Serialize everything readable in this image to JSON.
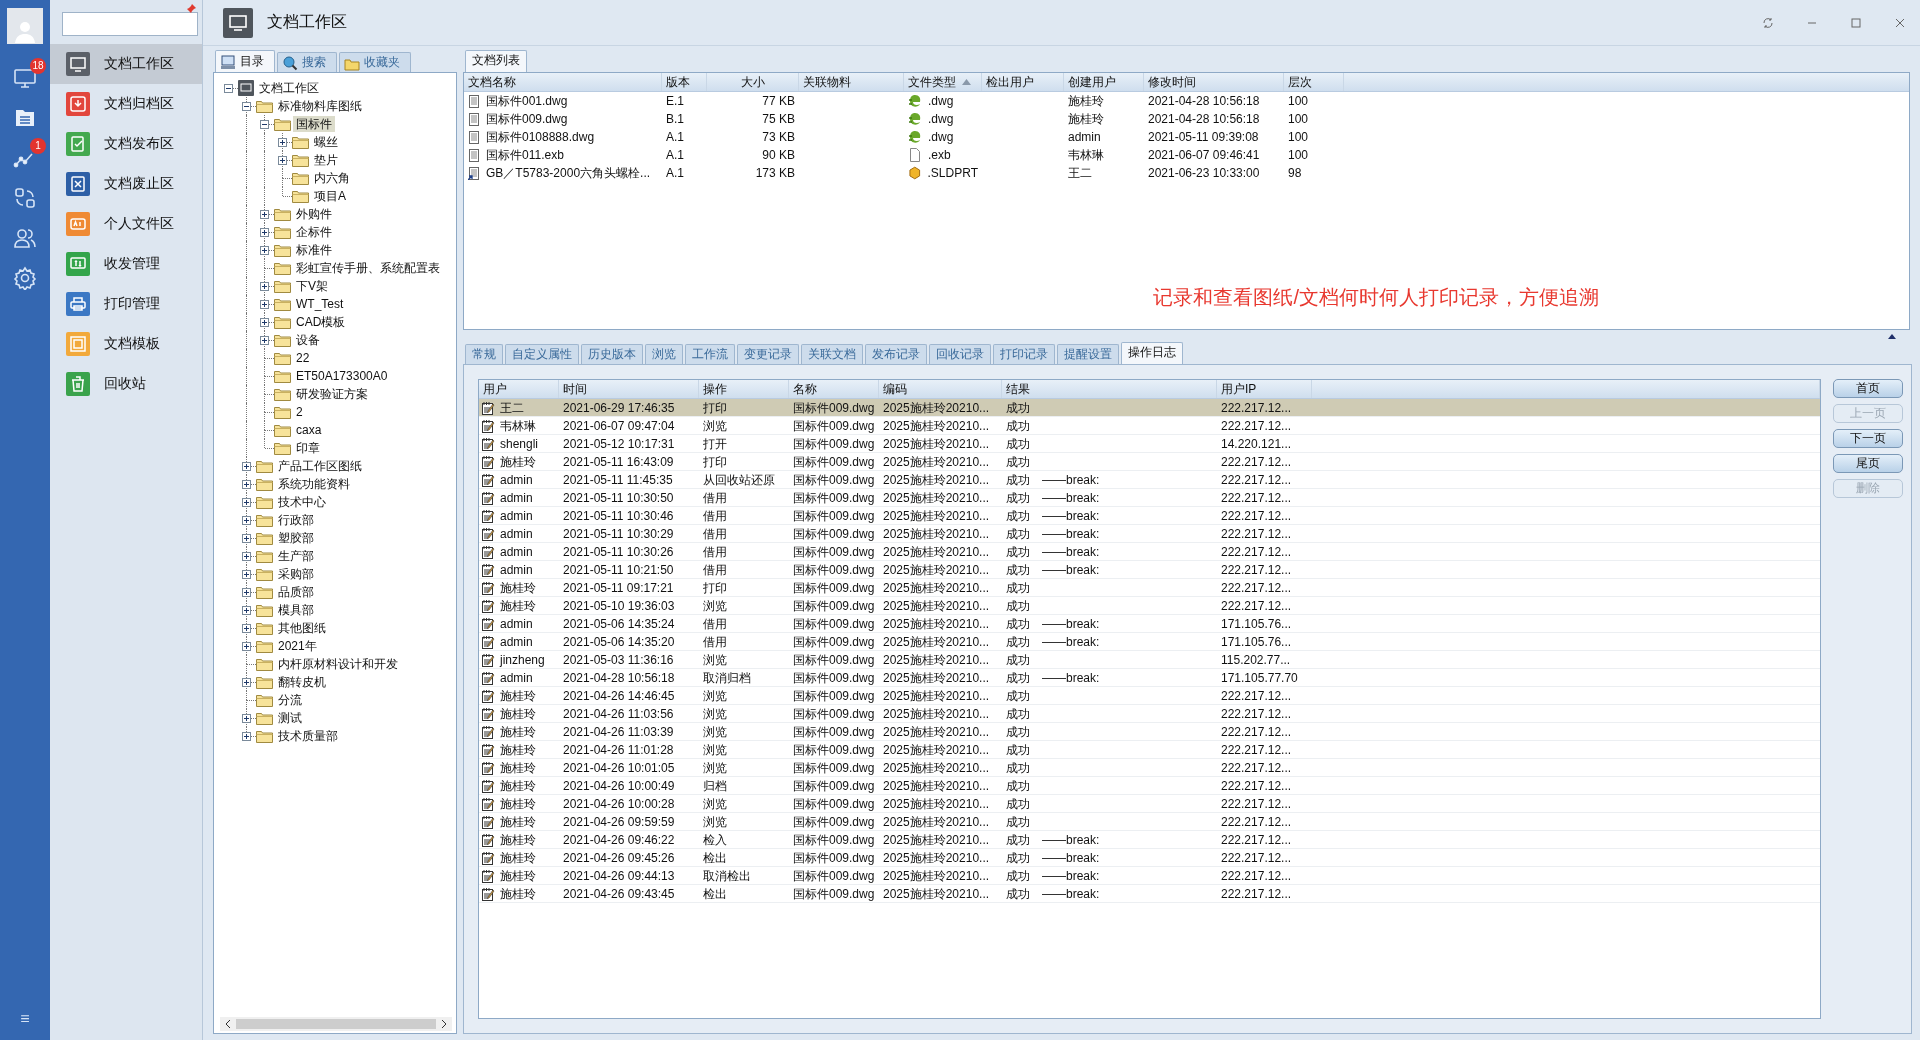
{
  "rail": {
    "items": [
      {
        "kind": "monitor",
        "badge": "18"
      },
      {
        "kind": "list"
      },
      {
        "kind": "chart",
        "badge": "1"
      },
      {
        "kind": "sync"
      },
      {
        "kind": "users"
      },
      {
        "kind": "gear"
      }
    ],
    "menu": "≡"
  },
  "nav": [
    {
      "label": "文档工作区",
      "kind": "monitor",
      "selected": true
    },
    {
      "label": "文档归档区",
      "kind": "archive",
      "selected": false
    },
    {
      "label": "文档发布区",
      "kind": "publish",
      "selected": false
    },
    {
      "label": "文档废止区",
      "kind": "void",
      "selected": false
    },
    {
      "label": "个人文件区",
      "kind": "personal",
      "selected": false
    },
    {
      "label": "收发管理",
      "kind": "transfer",
      "selected": false
    },
    {
      "label": "打印管理",
      "kind": "printer",
      "selected": false
    },
    {
      "label": "文档模板",
      "kind": "template",
      "selected": false
    },
    {
      "label": "回收站",
      "kind": "trash",
      "selected": false
    }
  ],
  "title": "文档工作区",
  "tree_tabs": [
    {
      "label": "目录",
      "kind": "catalog",
      "selected": true
    },
    {
      "label": "搜索",
      "kind": "search",
      "selected": false
    },
    {
      "label": "收藏夹",
      "kind": "favorites",
      "selected": false
    }
  ],
  "tree": {
    "label": "文档工作区",
    "expanded": true,
    "selected": false,
    "children": [
      {
        "label": "标准物料库图纸",
        "expanded": true,
        "selected": false,
        "children": [
          {
            "label": "国标件",
            "expanded": true,
            "selected": true,
            "children": [
              {
                "label": "螺丝",
                "expanded": false,
                "selected": false
              },
              {
                "label": "垫片",
                "expanded": false,
                "selected": false
              },
              {
                "label": "内六角",
                "selected": false
              },
              {
                "label": "项目A",
                "selected": false
              }
            ]
          },
          {
            "label": "外购件",
            "expanded": false,
            "selected": false
          },
          {
            "label": "企标件",
            "expanded": false,
            "selected": false
          },
          {
            "label": "标准件",
            "expanded": false,
            "selected": false
          },
          {
            "label": "彩虹宣传手册、系统配置表",
            "selected": false
          },
          {
            "label": "下V架",
            "expanded": false,
            "selected": false
          },
          {
            "label": "WT_Test",
            "expanded": false,
            "selected": false
          },
          {
            "label": "CAD模板",
            "expanded": false,
            "selected": false
          },
          {
            "label": "设备",
            "expanded": false,
            "selected": false
          },
          {
            "label": "22",
            "selected": false
          },
          {
            "label": "ET50A173300A0",
            "selected": false
          },
          {
            "label": "研发验证方案",
            "selected": false
          },
          {
            "label": "2",
            "selected": false
          },
          {
            "label": "caxa",
            "selected": false
          },
          {
            "label": "印章",
            "selected": false
          }
        ]
      },
      {
        "label": "产品工作区图纸",
        "expanded": false,
        "selected": false
      },
      {
        "label": "系统功能资料",
        "expanded": false,
        "selected": false
      },
      {
        "label": "技术中心",
        "expanded": false,
        "selected": false
      },
      {
        "label": "行政部",
        "expanded": false,
        "selected": false
      },
      {
        "label": "塑胶部",
        "expanded": false,
        "selected": false
      },
      {
        "label": "生产部",
        "expanded": false,
        "selected": false
      },
      {
        "label": "采购部",
        "expanded": false,
        "selected": false
      },
      {
        "label": "品质部",
        "expanded": false,
        "selected": false
      },
      {
        "label": "模具部",
        "expanded": false,
        "selected": false
      },
      {
        "label": "其他图纸",
        "expanded": false,
        "selected": false
      },
      {
        "label": "2021年",
        "expanded": false,
        "selected": false
      },
      {
        "label": "内杆原材料设计和开发",
        "selected": false
      },
      {
        "label": "翻转皮机",
        "expanded": false,
        "selected": false
      },
      {
        "label": "分流",
        "selected": false
      },
      {
        "label": "测试",
        "expanded": false,
        "selected": false
      },
      {
        "label": "技术质量部",
        "expanded": false,
        "selected": false
      }
    ]
  },
  "doc_list": {
    "tab": "文档列表",
    "columns": [
      {
        "label": "文档名称"
      },
      {
        "label": "版本"
      },
      {
        "label": "大小"
      },
      {
        "label": "关联物料"
      },
      {
        "label": "文件类型",
        "sorted": true
      },
      {
        "label": "检出用户"
      },
      {
        "label": "创建用户"
      },
      {
        "label": "修改时间"
      },
      {
        "label": "层次"
      }
    ],
    "rows": [
      {
        "kind": "document",
        "name": "国标件001.dwg",
        "version": "E.1",
        "size": "77 KB",
        "file_type": {
          "kind": "dwg",
          "text": ".dwg"
        },
        "creator": "施桂玲",
        "modified": "2021-04-28 10:56:18",
        "layer": "100"
      },
      {
        "kind": "document",
        "name": "国标件009.dwg",
        "version": "B.1",
        "size": "75 KB",
        "file_type": {
          "kind": "dwg",
          "text": ".dwg"
        },
        "creator": "施桂玲",
        "modified": "2021-04-28 10:56:18",
        "layer": "100"
      },
      {
        "kind": "document",
        "name": "国标件0108888.dwg",
        "version": "A.1",
        "size": "73 KB",
        "file_type": {
          "kind": "dwg",
          "text": ".dwg"
        },
        "creator": "admin",
        "modified": "2021-05-11 09:39:08",
        "layer": "100"
      },
      {
        "kind": "document",
        "name": "国标件011.exb",
        "version": "A.1",
        "size": "90 KB",
        "file_type": {
          "kind": "exb",
          "text": ".exb"
        },
        "creator": "韦林琳",
        "modified": "2021-06-07 09:46:41",
        "layer": "100"
      },
      {
        "kind": "shortcut",
        "name": "GB／T5783-2000六角头螺栓...",
        "version": "A.1",
        "size": "173 KB",
        "file_type": {
          "kind": "sldprt",
          "text": ".SLDPRT"
        },
        "creator": "王二",
        "modified": "2021-06-23 10:33:00",
        "layer": "98"
      }
    ]
  },
  "annotation": "记录和查看图纸/文档何时何人打印记录，方便追溯",
  "detail_tabs": [
    {
      "label": "常规",
      "selected": false
    },
    {
      "label": "自定义属性",
      "selected": false
    },
    {
      "label": "历史版本",
      "selected": false
    },
    {
      "label": "浏览",
      "selected": false
    },
    {
      "label": "工作流",
      "selected": false
    },
    {
      "label": "变更记录",
      "selected": false
    },
    {
      "label": "关联文档",
      "selected": false
    },
    {
      "label": "发布记录",
      "selected": false
    },
    {
      "label": "回收记录",
      "selected": false
    },
    {
      "label": "打印记录",
      "selected": false
    },
    {
      "label": "提醒设置",
      "selected": false
    },
    {
      "label": "操作日志",
      "selected": true
    }
  ],
  "log": {
    "columns": [
      "用户",
      "时间",
      "操作",
      "名称",
      "编码",
      "结果",
      "用户IP"
    ],
    "rows": [
      {
        "user": "王二",
        "time": "2021-06-29 17:46:35",
        "action": "打印",
        "name": "国标件009.dwg",
        "code": "2025施桂玲20210...",
        "result": "成功",
        "ip": "222.217.12...",
        "selected": true
      },
      {
        "user": "韦林琳",
        "time": "2021-06-07 09:47:04",
        "action": "浏览",
        "name": "国标件009.dwg",
        "code": "2025施桂玲20210...",
        "result": "成功",
        "ip": "222.217.12...",
        "selected": false
      },
      {
        "user": "shengli",
        "time": "2021-05-12 10:17:31",
        "action": "打开",
        "name": "国标件009.dwg",
        "code": "2025施桂玲20210...",
        "result": "成功",
        "ip": "14.220.121...",
        "selected": false
      },
      {
        "user": "施桂玲",
        "time": "2021-05-11 16:43:09",
        "action": "打印",
        "name": "国标件009.dwg",
        "code": "2025施桂玲20210...",
        "result": "成功",
        "ip": "222.217.12...",
        "selected": false
      },
      {
        "user": "admin",
        "time": "2021-05-11 11:45:35",
        "action": "从回收站还原",
        "name": "国标件009.dwg",
        "code": "2025施桂玲20210...",
        "result": "成功",
        "note": "——break:",
        "ip": "222.217.12...",
        "selected": false
      },
      {
        "user": "admin",
        "time": "2021-05-11 10:30:50",
        "action": "借用",
        "name": "国标件009.dwg",
        "code": "2025施桂玲20210...",
        "result": "成功",
        "note": "——break:",
        "ip": "222.217.12...",
        "selected": false
      },
      {
        "user": "admin",
        "time": "2021-05-11 10:30:46",
        "action": "借用",
        "name": "国标件009.dwg",
        "code": "2025施桂玲20210...",
        "result": "成功",
        "note": "——break:",
        "ip": "222.217.12...",
        "selected": false
      },
      {
        "user": "admin",
        "time": "2021-05-11 10:30:29",
        "action": "借用",
        "name": "国标件009.dwg",
        "code": "2025施桂玲20210...",
        "result": "成功",
        "note": "——break:",
        "ip": "222.217.12...",
        "selected": false
      },
      {
        "user": "admin",
        "time": "2021-05-11 10:30:26",
        "action": "借用",
        "name": "国标件009.dwg",
        "code": "2025施桂玲20210...",
        "result": "成功",
        "note": "——break:",
        "ip": "222.217.12...",
        "selected": false
      },
      {
        "user": "admin",
        "time": "2021-05-11 10:21:50",
        "action": "借用",
        "name": "国标件009.dwg",
        "code": "2025施桂玲20210...",
        "result": "成功",
        "note": "——break:",
        "ip": "222.217.12...",
        "selected": false
      },
      {
        "user": "施桂玲",
        "time": "2021-05-11 09:17:21",
        "action": "打印",
        "name": "国标件009.dwg",
        "code": "2025施桂玲20210...",
        "result": "成功",
        "ip": "222.217.12...",
        "selected": false
      },
      {
        "user": "施桂玲",
        "time": "2021-05-10 19:36:03",
        "action": "浏览",
        "name": "国标件009.dwg",
        "code": "2025施桂玲20210...",
        "result": "成功",
        "ip": "222.217.12...",
        "selected": false
      },
      {
        "user": "admin",
        "time": "2021-05-06 14:35:24",
        "action": "借用",
        "name": "国标件009.dwg",
        "code": "2025施桂玲20210...",
        "result": "成功",
        "note": "——break:",
        "ip": "171.105.76...",
        "selected": false
      },
      {
        "user": "admin",
        "time": "2021-05-06 14:35:20",
        "action": "借用",
        "name": "国标件009.dwg",
        "code": "2025施桂玲20210...",
        "result": "成功",
        "note": "——break:",
        "ip": "171.105.76...",
        "selected": false
      },
      {
        "user": "jinzheng",
        "time": "2021-05-03 11:36:16",
        "action": "浏览",
        "name": "国标件009.dwg",
        "code": "2025施桂玲20210...",
        "result": "成功",
        "ip": "115.202.77...",
        "selected": false
      },
      {
        "user": "admin",
        "time": "2021-04-28 10:56:18",
        "action": "取消归档",
        "name": "国标件009.dwg",
        "code": "2025施桂玲20210...",
        "result": "成功",
        "note": "——break:",
        "ip": "171.105.77.70",
        "selected": false
      },
      {
        "user": "施桂玲",
        "time": "2021-04-26 14:46:45",
        "action": "浏览",
        "name": "国标件009.dwg",
        "code": "2025施桂玲20210...",
        "result": "成功",
        "ip": "222.217.12...",
        "selected": false
      },
      {
        "user": "施桂玲",
        "time": "2021-04-26 11:03:56",
        "action": "浏览",
        "name": "国标件009.dwg",
        "code": "2025施桂玲20210...",
        "result": "成功",
        "ip": "222.217.12...",
        "selected": false
      },
      {
        "user": "施桂玲",
        "time": "2021-04-26 11:03:39",
        "action": "浏览",
        "name": "国标件009.dwg",
        "code": "2025施桂玲20210...",
        "result": "成功",
        "ip": "222.217.12...",
        "selected": false
      },
      {
        "user": "施桂玲",
        "time": "2021-04-26 11:01:28",
        "action": "浏览",
        "name": "国标件009.dwg",
        "code": "2025施桂玲20210...",
        "result": "成功",
        "ip": "222.217.12...",
        "selected": false
      },
      {
        "user": "施桂玲",
        "time": "2021-04-26 10:01:05",
        "action": "浏览",
        "name": "国标件009.dwg",
        "code": "2025施桂玲20210...",
        "result": "成功",
        "ip": "222.217.12...",
        "selected": false
      },
      {
        "user": "施桂玲",
        "time": "2021-04-26 10:00:49",
        "action": "归档",
        "name": "国标件009.dwg",
        "code": "2025施桂玲20210...",
        "result": "成功",
        "ip": "222.217.12...",
        "selected": false
      },
      {
        "user": "施桂玲",
        "time": "2021-04-26 10:00:28",
        "action": "浏览",
        "name": "国标件009.dwg",
        "code": "2025施桂玲20210...",
        "result": "成功",
        "ip": "222.217.12...",
        "selected": false
      },
      {
        "user": "施桂玲",
        "time": "2021-04-26 09:59:59",
        "action": "浏览",
        "name": "国标件009.dwg",
        "code": "2025施桂玲20210...",
        "result": "成功",
        "ip": "222.217.12...",
        "selected": false
      },
      {
        "user": "施桂玲",
        "time": "2021-04-26 09:46:22",
        "action": "检入",
        "name": "国标件009.dwg",
        "code": "2025施桂玲20210...",
        "result": "成功",
        "note": "——break:",
        "ip": "222.217.12...",
        "selected": false
      },
      {
        "user": "施桂玲",
        "time": "2021-04-26 09:45:26",
        "action": "检出",
        "name": "国标件009.dwg",
        "code": "2025施桂玲20210...",
        "result": "成功",
        "note": "——break:",
        "ip": "222.217.12...",
        "selected": false
      },
      {
        "user": "施桂玲",
        "time": "2021-04-26 09:44:13",
        "action": "取消检出",
        "name": "国标件009.dwg",
        "code": "2025施桂玲20210...",
        "result": "成功",
        "note": "——break:",
        "ip": "222.217.12...",
        "selected": false
      },
      {
        "user": "施桂玲",
        "time": "2021-04-26 09:43:45",
        "action": "检出",
        "name": "国标件009.dwg",
        "code": "2025施桂玲20210...",
        "result": "成功",
        "note": "——break:",
        "ip": "222.217.12...",
        "selected": false
      }
    ]
  },
  "buttons": [
    {
      "label": "首页",
      "disabled": false
    },
    {
      "label": "上一页",
      "disabled": true
    },
    {
      "label": "下一页",
      "disabled": false
    },
    {
      "label": "尾页",
      "disabled": false
    },
    {
      "label": "删除",
      "disabled": true
    }
  ]
}
